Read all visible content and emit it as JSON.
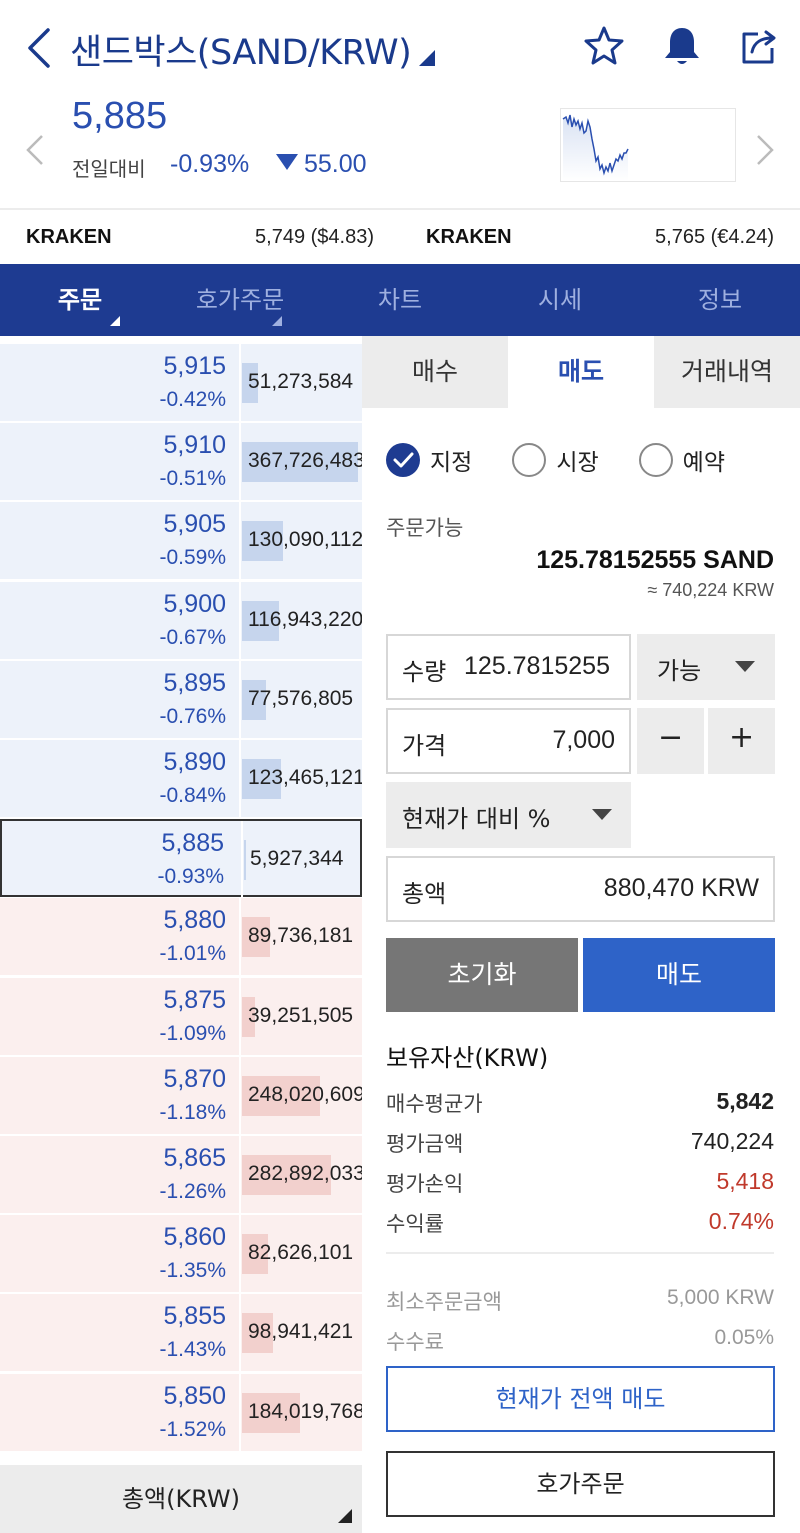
{
  "header": {
    "title": "샌드박스(SAND/KRW)",
    "current_price": "5,885",
    "change_label": "전일대비",
    "change_pct": "-0.93%",
    "change_abs": "55.00",
    "change_direction": "down"
  },
  "external": [
    {
      "exchange": "KRAKEN",
      "value": "5,749 ($4.83)"
    },
    {
      "exchange": "KRAKEN",
      "value": "5,765 (€4.24)"
    }
  ],
  "tabs": [
    {
      "label": "주문",
      "active": true,
      "has_caret": true
    },
    {
      "label": "호가주문",
      "active": false,
      "has_caret": true
    },
    {
      "label": "차트",
      "active": false,
      "has_caret": false
    },
    {
      "label": "시세",
      "active": false,
      "has_caret": false
    },
    {
      "label": "정보",
      "active": false,
      "has_caret": false
    }
  ],
  "orderbook": {
    "rows": [
      {
        "price": "5,915",
        "pct": "-0.42%",
        "volume": "51,273,584",
        "side": "ask",
        "bar": 0.14
      },
      {
        "price": "5,910",
        "pct": "-0.51%",
        "volume": "367,726,483",
        "side": "ask",
        "bar": 1.0
      },
      {
        "price": "5,905",
        "pct": "-0.59%",
        "volume": "130,090,112",
        "side": "ask",
        "bar": 0.35
      },
      {
        "price": "5,900",
        "pct": "-0.67%",
        "volume": "116,943,220",
        "side": "ask",
        "bar": 0.32
      },
      {
        "price": "5,895",
        "pct": "-0.76%",
        "volume": "77,576,805",
        "side": "ask",
        "bar": 0.21
      },
      {
        "price": "5,890",
        "pct": "-0.84%",
        "volume": "123,465,121",
        "side": "ask",
        "bar": 0.34
      },
      {
        "price": "5,885",
        "pct": "-0.93%",
        "volume": "5,927,344",
        "side": "ask",
        "bar": 0.02,
        "current": true
      },
      {
        "price": "5,880",
        "pct": "-1.01%",
        "volume": "89,736,181",
        "side": "bid",
        "bar": 0.24
      },
      {
        "price": "5,875",
        "pct": "-1.09%",
        "volume": "39,251,505",
        "side": "bid",
        "bar": 0.11
      },
      {
        "price": "5,870",
        "pct": "-1.18%",
        "volume": "248,020,609",
        "side": "bid",
        "bar": 0.67
      },
      {
        "price": "5,865",
        "pct": "-1.26%",
        "volume": "282,892,033",
        "side": "bid",
        "bar": 0.77
      },
      {
        "price": "5,860",
        "pct": "-1.35%",
        "volume": "82,626,101",
        "side": "bid",
        "bar": 0.22
      },
      {
        "price": "5,855",
        "pct": "-1.43%",
        "volume": "98,941,421",
        "side": "bid",
        "bar": 0.27
      },
      {
        "price": "5,850",
        "pct": "-1.52%",
        "volume": "184,019,768",
        "side": "bid",
        "bar": 0.5
      }
    ],
    "footer_label": "총액(KRW)"
  },
  "order_panel": {
    "subtabs": [
      {
        "label": "매수",
        "active": false
      },
      {
        "label": "매도",
        "active": true
      },
      {
        "label": "거래내역",
        "active": false
      }
    ],
    "order_types": [
      {
        "label": "지정",
        "checked": true
      },
      {
        "label": "시장",
        "checked": false
      },
      {
        "label": "예약",
        "checked": false
      }
    ],
    "available_label": "주문가능",
    "available_amount": "125.78152555 SAND",
    "available_krw": "≈ 740,224 KRW",
    "quantity_label": "수량",
    "quantity_value": "125.7815255",
    "quantity_option": "가능",
    "price_label": "가격",
    "price_value": "7,000",
    "minus": "−",
    "plus": "+",
    "pct_selector": "현재가 대비 %",
    "total_label": "총액",
    "total_value": "880,470 KRW",
    "reset_label": "초기화",
    "sell_label": "매도"
  },
  "holdings": {
    "title": "보유자산(KRW)",
    "rows": [
      {
        "label": "매수평균가",
        "value": "5,842",
        "style": "bold"
      },
      {
        "label": "평가금액",
        "value": "740,224",
        "style": "normal"
      },
      {
        "label": "평가손익",
        "value": "5,418",
        "style": "red"
      },
      {
        "label": "수익률",
        "value": "0.74%",
        "style": "red"
      }
    ]
  },
  "info": {
    "rows": [
      {
        "label": "최소주문금액",
        "value": "5,000 KRW"
      },
      {
        "label": "수수료",
        "value": "0.05%"
      }
    ],
    "sell_all_label": "현재가 전액 매도",
    "quote_order_label": "호가주문"
  },
  "colors": {
    "brand": "#1e3b91",
    "blue": "#2a4fb0",
    "sell": "#2e63c8",
    "red": "#c0392b",
    "ask_bg": "#edf2fa",
    "bid_bg": "#fbefee"
  }
}
